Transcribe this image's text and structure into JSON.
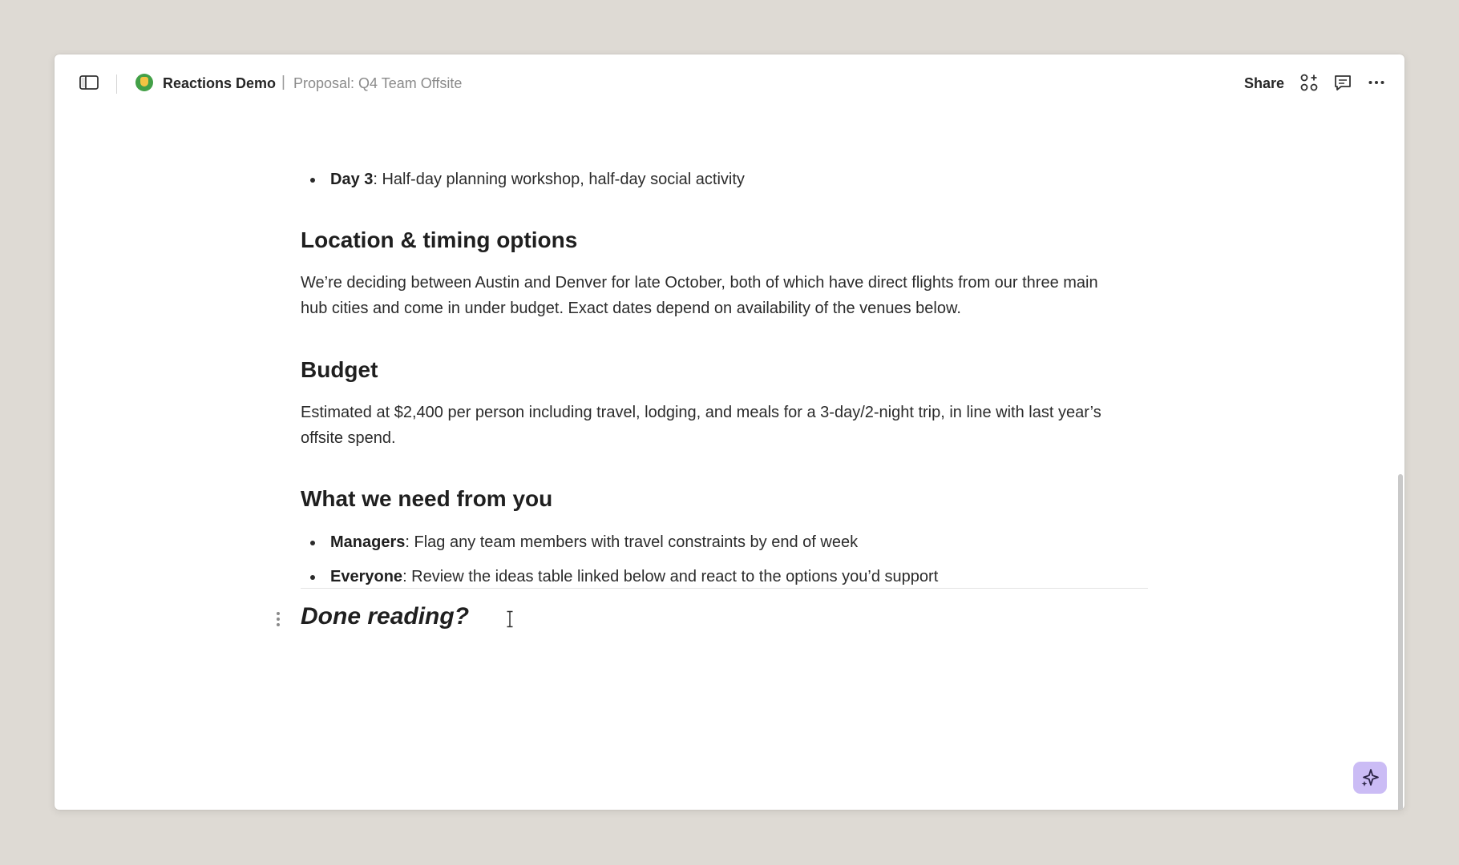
{
  "header": {
    "workspace_name": "Reactions Demo",
    "breadcrumb_separator": "|",
    "document_title": "Proposal: Q4 Team Offsite",
    "share_label": "Share"
  },
  "doc": {
    "intro_bullet": {
      "bold": "Day 3",
      "text": ": Half-day planning workshop, half-day social activity"
    },
    "sections": [
      {
        "heading": "Location & timing options",
        "body": "We’re deciding between Austin and Denver for late October, both of which have direct flights from our three main hub cities and come in under budget. Exact dates depend on availability of the venues below."
      },
      {
        "heading": "Budget",
        "body": "Estimated at $2,400 per person including travel, lodging, and meals for a 3-day/2-night trip, in line with last year’s offsite spend."
      },
      {
        "heading": "What we need from you",
        "bullets": [
          {
            "bold": "Managers",
            "text": ": Flag any team members with travel constraints by end of week"
          },
          {
            "bold": "Everyone",
            "text": ": Review the ideas table linked below and react to the options you’d support"
          }
        ]
      }
    ],
    "closing_heading": "Done reading?"
  },
  "icons": {
    "sidebar_toggle": "sidebar-toggle-icon",
    "apps": "apps-icon",
    "comments": "comment-icon",
    "more": "more-icon",
    "ai": "sparkle-icon"
  },
  "colors": {
    "background": "#dedad4",
    "window": "#ffffff",
    "workspace_badge": "#43a047",
    "ai_button": "#cbbcf5"
  }
}
